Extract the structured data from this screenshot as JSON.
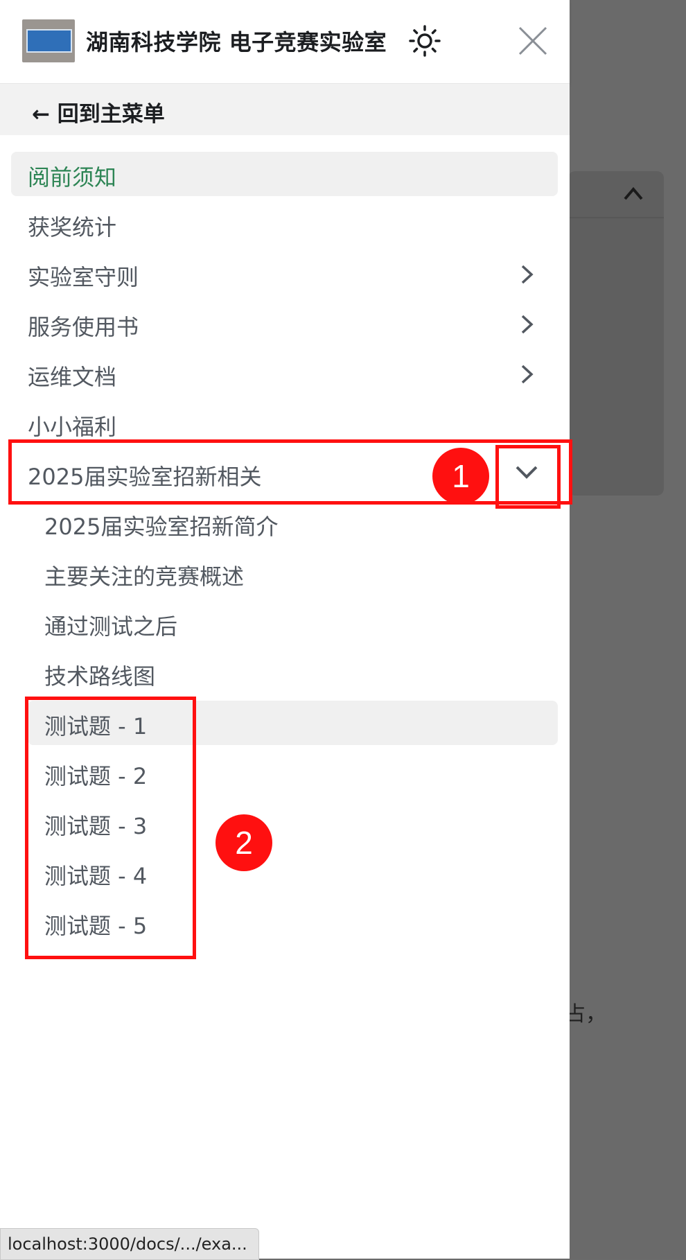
{
  "header": {
    "site_title": "湖南科技学院 电子竞赛实验室",
    "logo_icon": "lab-door-sign-logo",
    "theme_icon": "sun-icon",
    "close_icon": "close-icon"
  },
  "nav": {
    "back_label": "← 回到主菜单",
    "items": [
      {
        "label": "阅前须知",
        "active": true
      },
      {
        "label": "获奖统计"
      },
      {
        "label": "实验室守则",
        "has_children": true
      },
      {
        "label": "服务使用书",
        "has_children": true
      },
      {
        "label": "运维文档",
        "has_children": true
      },
      {
        "label": "小小福利"
      },
      {
        "label": "2025届实验室招新相关",
        "expanded": true
      }
    ],
    "sub_items": [
      {
        "label": "2025届实验室招新简介"
      },
      {
        "label": "主要关注的竞赛概述"
      },
      {
        "label": "通过测试之后"
      },
      {
        "label": "技术路线图"
      },
      {
        "label": "测试题 - 1",
        "hovered": true
      },
      {
        "label": "测试题 - 2"
      },
      {
        "label": "测试题 - 3"
      },
      {
        "label": "测试题 - 4"
      },
      {
        "label": "测试题 - 5"
      }
    ]
  },
  "annotations": {
    "marker_1": "1",
    "marker_2": "2",
    "color": "#ff1010"
  },
  "background": {
    "partial_text": "占，"
  },
  "status_bar": {
    "url": "localhost:3000/docs/.../exa..."
  },
  "colors": {
    "active_text": "#2e8555",
    "item_text": "#525860",
    "overlay": "#6b6b6b"
  }
}
